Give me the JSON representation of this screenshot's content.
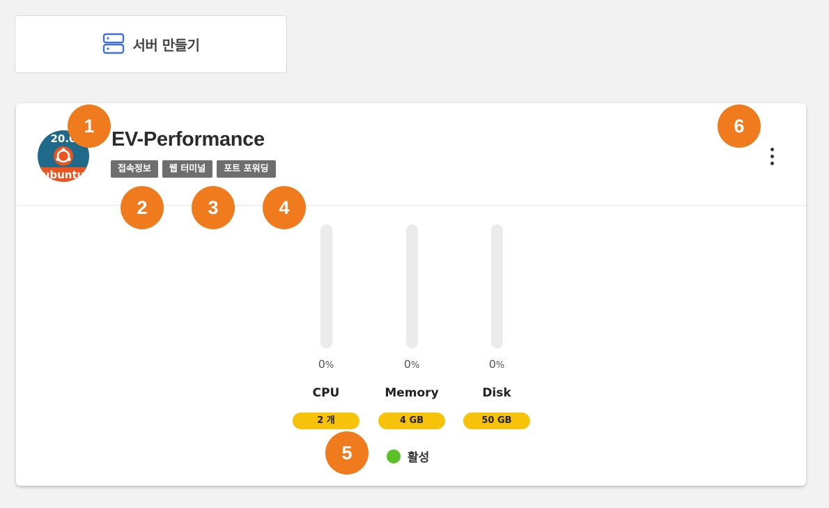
{
  "toolbar": {
    "create_server_label": "서버 만들기",
    "create_server_icon": "server-stack-icon"
  },
  "server": {
    "name": "EV-Performance",
    "os": {
      "logo_text": "ubuntu",
      "version_text": "20.0",
      "icon": "ubuntu-logo-icon"
    },
    "tags": [
      "접속정보",
      "웹 터미널",
      "포트 포워딩"
    ],
    "menu_icon": "kebab-menu-icon",
    "metrics": [
      {
        "name": "CPU",
        "percent": "0",
        "unit": "%",
        "usage": 0,
        "spec": "2 개"
      },
      {
        "name": "Memory",
        "percent": "0",
        "unit": "%",
        "usage": 0,
        "spec": "4 GB"
      },
      {
        "name": "Disk",
        "percent": "0",
        "unit": "%",
        "usage": 0,
        "spec": "50 GB"
      }
    ],
    "status": {
      "label": "활성",
      "color": "#5ac227"
    }
  },
  "annotations": [
    "1",
    "2",
    "3",
    "4",
    "5",
    "6"
  ],
  "colors": {
    "callout": "#f07a1e",
    "tag_bg": "#6e6e6e",
    "spec_pill": "#f7c20a",
    "icon_blue": "#3f6fd8",
    "ubuntu_orange": "#e95420",
    "ubuntu_circle": "#1f6a8a"
  }
}
